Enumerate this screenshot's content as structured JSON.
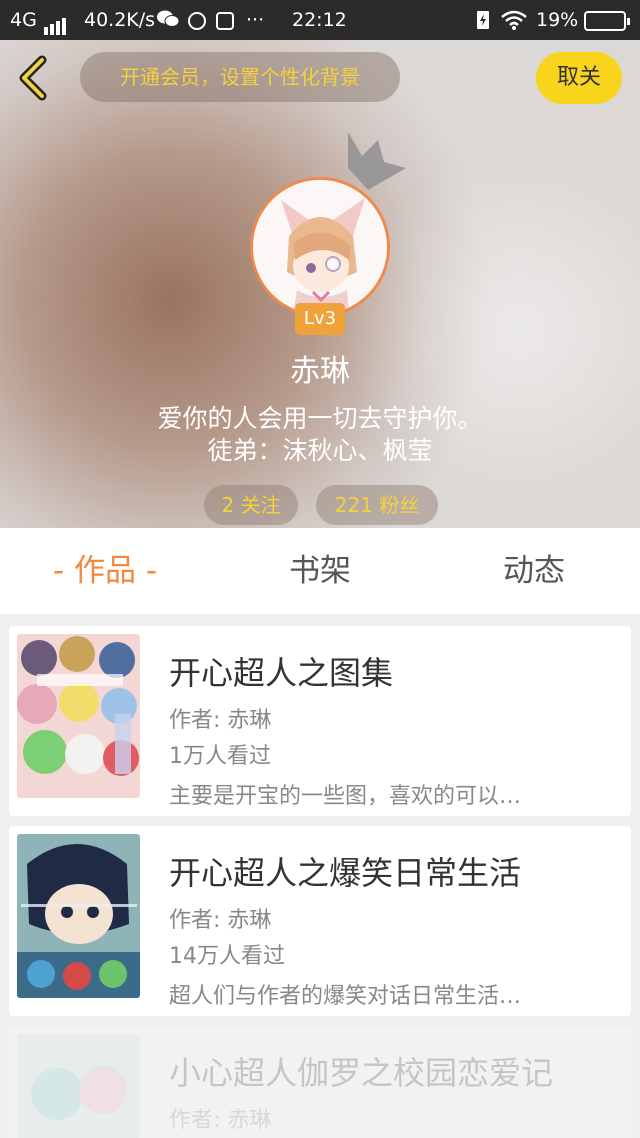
{
  "status_bar": {
    "network": "4G",
    "speed": "40.2K/s",
    "time": "22:12",
    "battery": "19%",
    "more": "···"
  },
  "header": {
    "vip_prompt": "开通会员，设置个性化背景",
    "follow_label": "取关",
    "level": "Lv3",
    "nickname": "赤琳",
    "bio_line1": "爱你的人会用一切去守护你。",
    "bio_line2": "徒弟：沫秋心、枫莹",
    "following": "2 关注",
    "followers": "221 粉丝"
  },
  "tabs": {
    "works": "- 作品 -",
    "bookshelf": "书架",
    "activity": "动态"
  },
  "works": [
    {
      "title": "开心超人之图集",
      "author": "作者: 赤琳",
      "views": "1万人看过",
      "desc": "主要是开宝的一些图，喜欢的可以…"
    },
    {
      "title": "开心超人之爆笑日常生活",
      "author": "作者: 赤琳",
      "views": "14万人看过",
      "desc": "超人们与作者的爆笑对话日常生活…"
    },
    {
      "title": "小心超人伽罗之校园恋爱记",
      "author": "作者: 赤琳"
    }
  ],
  "colors": {
    "accent_orange": "#f0893e",
    "follow_yellow": "#f8d51c",
    "vip_text": "#f5d13a"
  }
}
